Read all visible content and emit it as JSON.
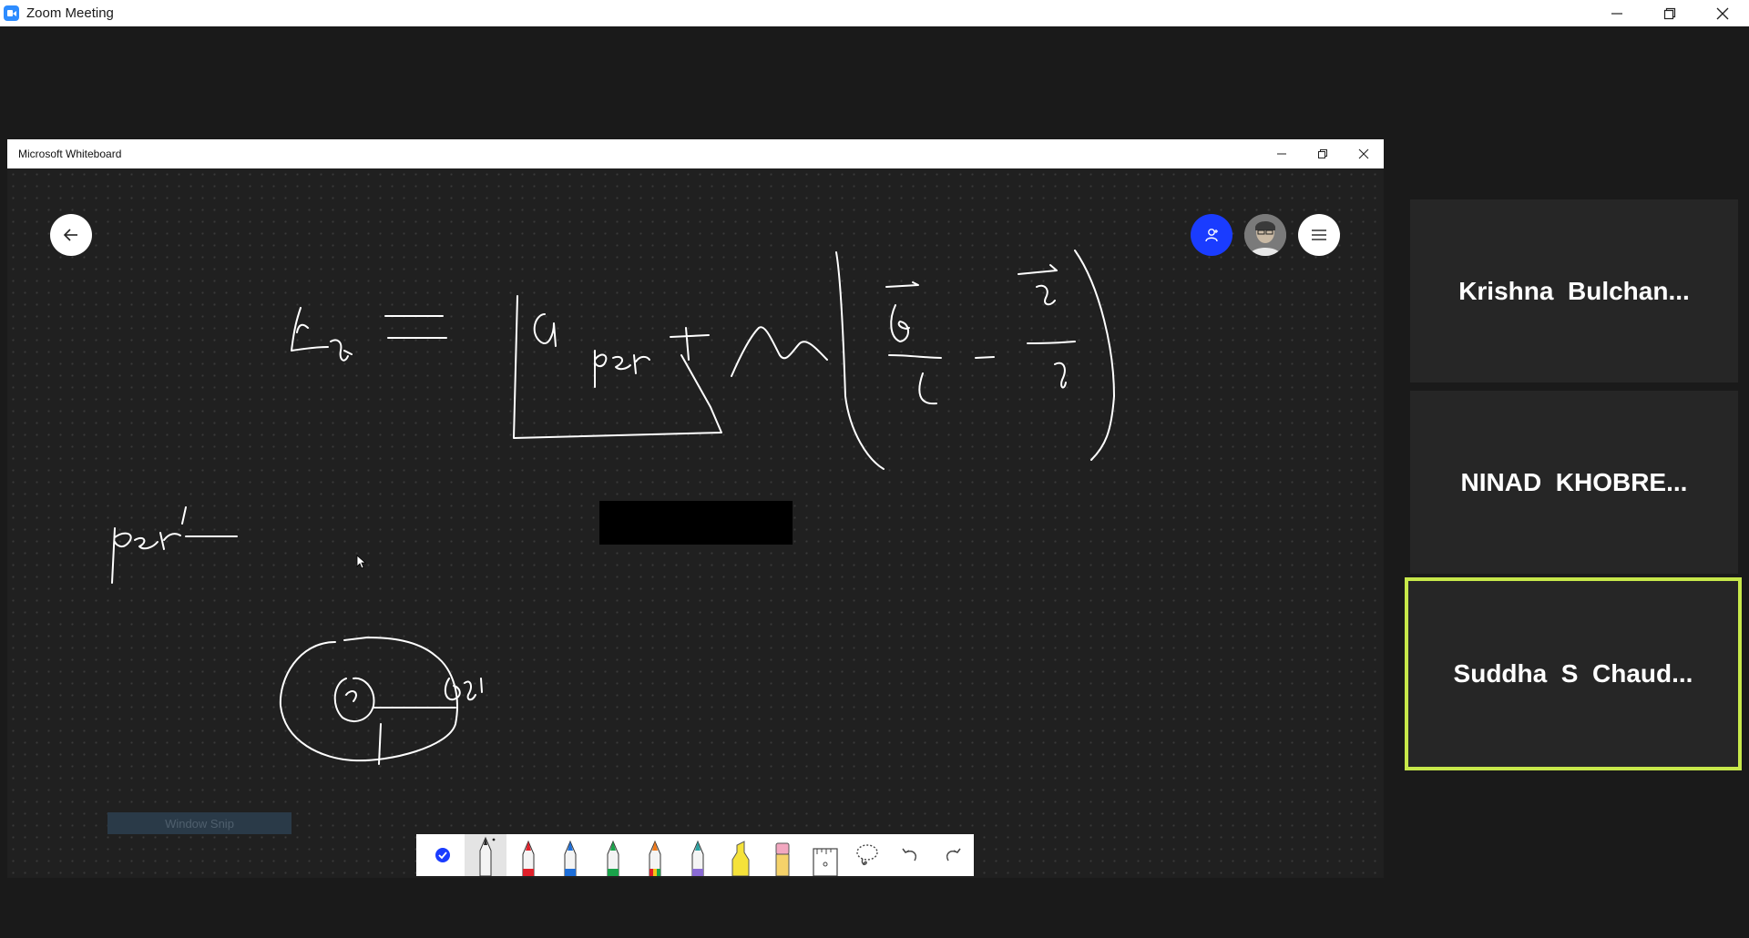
{
  "zoom": {
    "window_title": "Zoom Meeting",
    "controls": [
      "minimize",
      "restore",
      "close"
    ]
  },
  "whiteboard": {
    "window_title": "Microsoft Whiteboard",
    "snip_label": "Window Snip",
    "toolbar": {
      "tools": [
        {
          "name": "ink-to-shape-toggle-icon",
          "color": "#1a3cff"
        },
        {
          "name": "black-pen-icon",
          "color": "#222222",
          "selected": true
        },
        {
          "name": "red-pen-icon",
          "color": "#e0202a"
        },
        {
          "name": "blue-pen-icon",
          "color": "#1e6fd9"
        },
        {
          "name": "green-pen-icon",
          "color": "#1aa34a"
        },
        {
          "name": "rainbow-pen-icon",
          "color": "#f07a1a"
        },
        {
          "name": "galaxy-pen-icon",
          "color": "#8a6bd4"
        },
        {
          "name": "highlighter-icon",
          "color": "#f5e23a"
        },
        {
          "name": "eraser-icon",
          "color": "#f2a7c0"
        },
        {
          "name": "ruler-icon",
          "color": "#444444"
        },
        {
          "name": "lasso-select-icon",
          "color": "#444444"
        },
        {
          "name": "undo-icon",
          "color": "#444444"
        },
        {
          "name": "redo-icon",
          "color": "#444444"
        }
      ]
    }
  },
  "participants": [
    {
      "name": "Krishna  Bulchan...",
      "active": false
    },
    {
      "name": "NINAD  KHOBRE...",
      "active": false
    },
    {
      "name": "Suddha  S  Chaud...",
      "active": true
    }
  ],
  "colors": {
    "zoom_blue": "#2d8cff",
    "active_speaker_border": "#c7e84a",
    "invite_blue": "#1a3cff",
    "ink": "#ffffff"
  }
}
